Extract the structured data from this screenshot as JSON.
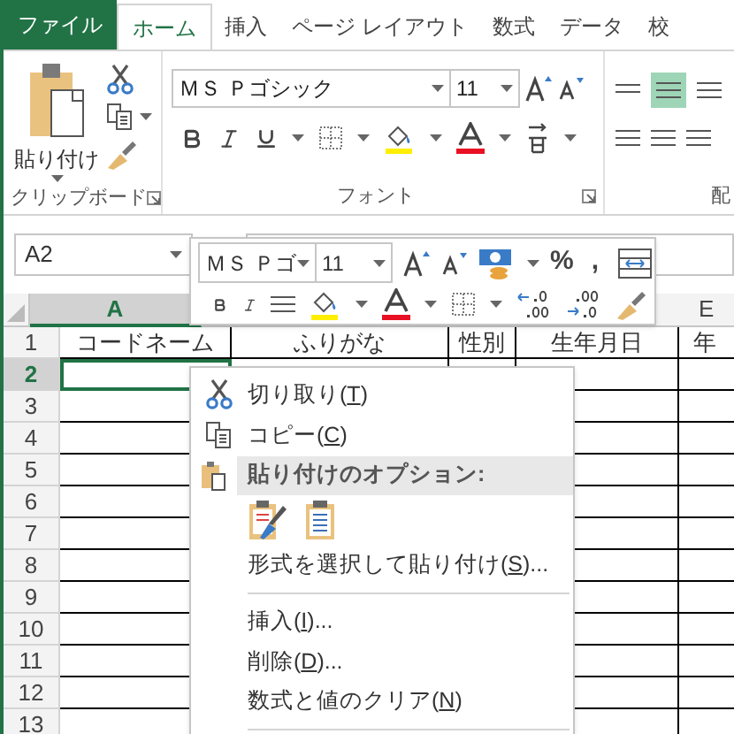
{
  "tabs": [
    {
      "label": "ファイル",
      "kind": "file"
    },
    {
      "label": "ホーム",
      "kind": "tab",
      "selected": true
    },
    {
      "label": "挿入",
      "kind": "tab",
      "selected": false
    },
    {
      "label": "ページ レイアウト",
      "kind": "tab",
      "selected": false
    },
    {
      "label": "数式",
      "kind": "tab",
      "selected": false
    },
    {
      "label": "データ",
      "kind": "tab",
      "selected": false
    },
    {
      "label": "校",
      "kind": "tab",
      "selected": false
    }
  ],
  "ribbon": {
    "paste_label": "貼り付け",
    "font_name": "ＭＳ Ｐゴシック",
    "font_size": "11",
    "groups": [
      "クリップボード",
      "フォント",
      "配"
    ]
  },
  "name_box": "A2",
  "mini_toolbar": {
    "font_name": "ＭＳ Ｐゴ",
    "font_size": "11",
    "percent": "%",
    "comma": ","
  },
  "sheet": {
    "columns": [
      {
        "label": "A",
        "selected": true
      },
      null,
      null,
      null,
      {
        "label": "E",
        "selected": false
      }
    ],
    "rows": [
      {
        "label": "1",
        "selected": false,
        "cells": [
          "コードネーム",
          "ふりがな",
          "性別",
          "生年月日",
          "年"
        ]
      },
      {
        "label": "2",
        "selected": true,
        "cells": []
      },
      {
        "label": "3",
        "selected": false,
        "cells": []
      },
      {
        "label": "4",
        "selected": false,
        "cells": []
      },
      {
        "label": "5",
        "selected": false,
        "cells": []
      },
      {
        "label": "6",
        "selected": false,
        "cells": []
      },
      {
        "label": "7",
        "selected": false,
        "cells": []
      },
      {
        "label": "8",
        "selected": false,
        "cells": []
      },
      {
        "label": "9",
        "selected": false,
        "cells": []
      },
      {
        "label": "10",
        "selected": false,
        "cells": []
      },
      {
        "label": "11",
        "selected": false,
        "cells": []
      },
      {
        "label": "12",
        "selected": false,
        "cells": []
      },
      {
        "label": "13",
        "selected": false,
        "cells": []
      }
    ]
  },
  "context_menu": [
    {
      "kind": "cut",
      "label": "切り取り(",
      "key": "T",
      "tail": ")"
    },
    {
      "kind": "copy",
      "label": "コピー(",
      "key": "C",
      "tail": ")"
    },
    {
      "kind": "header",
      "label": "貼り付けのオプション:"
    },
    {
      "kind": "paste_icons"
    },
    {
      "kind": "item",
      "label": "形式を選択して貼り付け(",
      "key": "S",
      "tail": ")..."
    },
    {
      "kind": "divider"
    },
    {
      "kind": "item",
      "label": "挿入(",
      "key": "I",
      "tail": ")..."
    },
    {
      "kind": "item",
      "label": "削除(",
      "key": "D",
      "tail": ")..."
    },
    {
      "kind": "item",
      "label": "数式と値のクリア(",
      "key": "N",
      "tail": ")"
    },
    {
      "kind": "divider"
    }
  ]
}
